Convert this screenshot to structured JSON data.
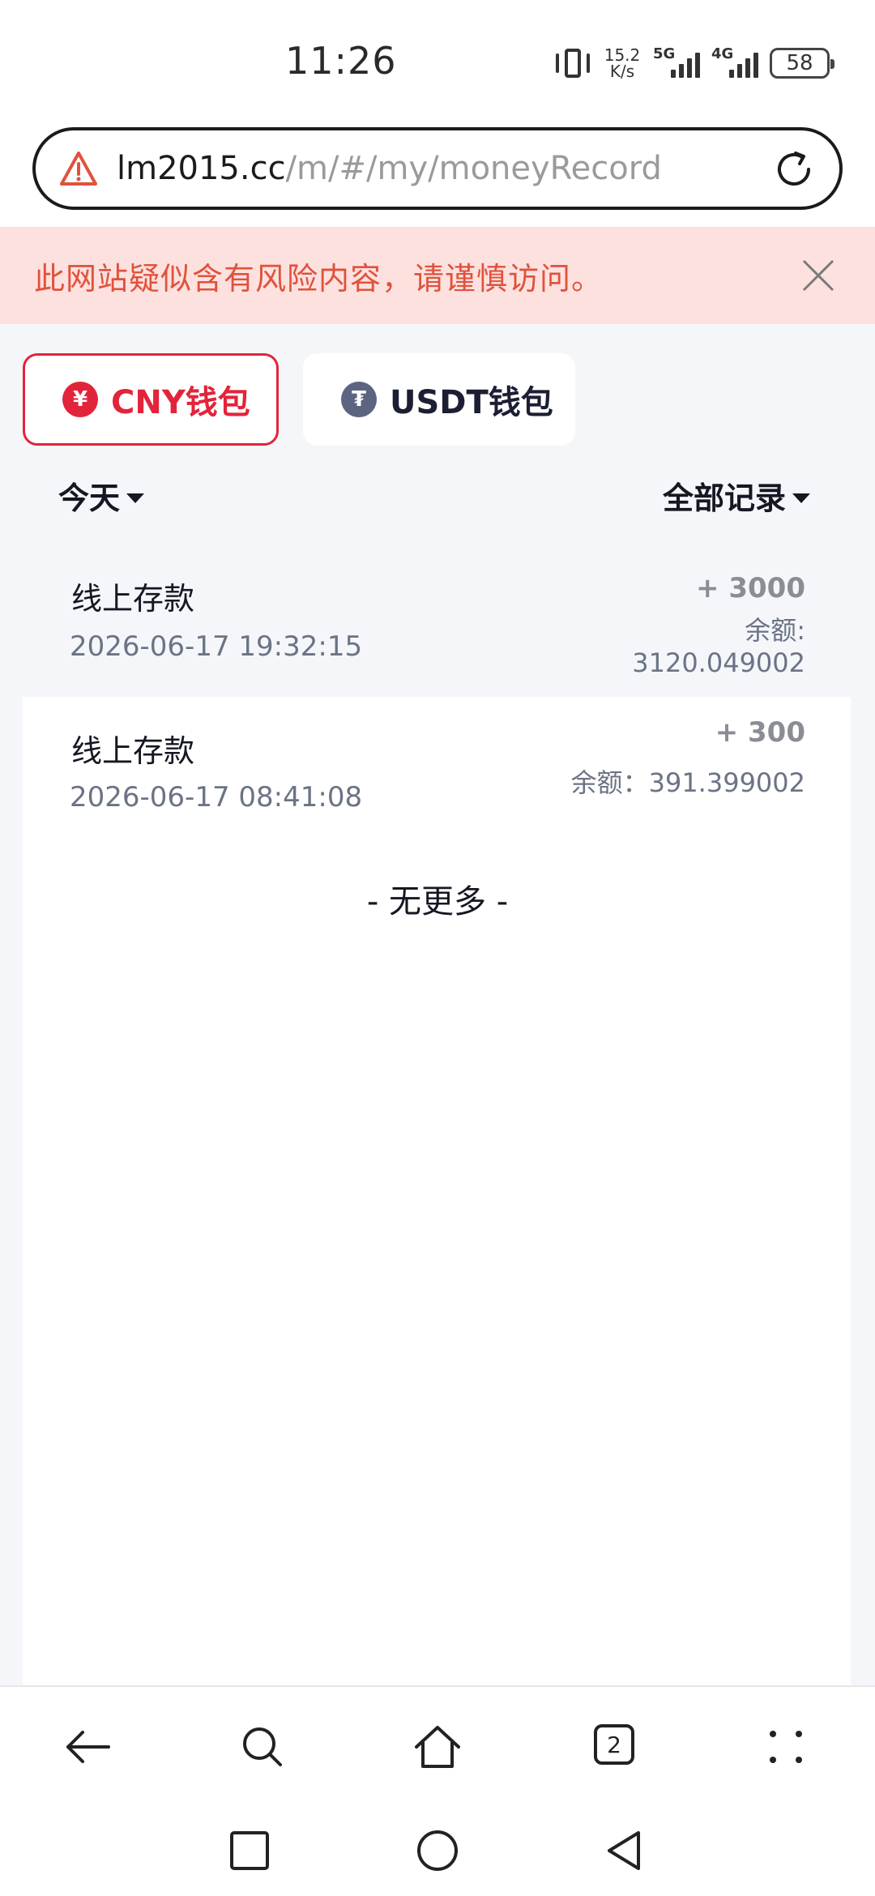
{
  "status_bar": {
    "time": "11:26",
    "net_speed_value": "15.2",
    "net_speed_unit": "K/s",
    "signal1_label": "5G",
    "signal2_label": "4G",
    "battery": "58"
  },
  "browser": {
    "url_host": "lm2015.cc",
    "url_path": "/m/#/my/moneyRecord",
    "risk_warning": "此网站疑似含有风险内容，请谨慎访问。",
    "tab_count": "2"
  },
  "wallet_tabs": [
    {
      "label": "CNY钱包",
      "icon": "yen-icon",
      "active": true
    },
    {
      "label": "USDT钱包",
      "icon": "tether-icon",
      "active": false
    }
  ],
  "filters": {
    "date": "今天",
    "type": "全部记录"
  },
  "records": [
    {
      "type": "线上存款",
      "time": "2026-06-17 19:32:15",
      "amount": "+ 3000",
      "balance_label": "余额:",
      "balance_value": "3120.049002"
    },
    {
      "type": "线上存款",
      "time": "2026-06-17 08:41:08",
      "amount": "+ 300",
      "balance_label": "余额：",
      "balance_value": "391.399002"
    }
  ],
  "end_text": "- 无更多 -",
  "colors": {
    "accent": "#e2243b",
    "warning_text": "#e0523c",
    "warning_bg": "#fde1df",
    "usdt_icon": "#5c6482",
    "content_bg": "#f4f6fa"
  }
}
